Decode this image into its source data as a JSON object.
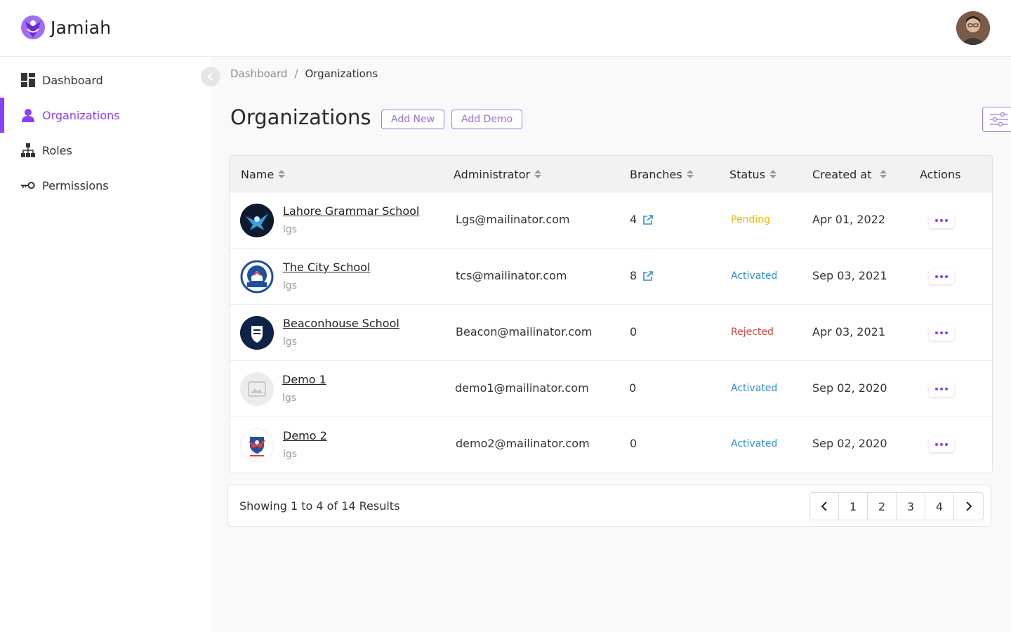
{
  "brand": {
    "name": "Jamiah",
    "accent": "#8a3ffc"
  },
  "nav": {
    "items": [
      {
        "label": "Dashboard",
        "icon": "dashboard-icon"
      },
      {
        "label": "Organizations",
        "icon": "user-icon",
        "active": true
      },
      {
        "label": "Roles",
        "icon": "hierarchy-icon"
      },
      {
        "label": "Permissions",
        "icon": "key-icon"
      }
    ]
  },
  "breadcrumb": {
    "parent": "Dashboard",
    "separator": "/",
    "current": "Organizations"
  },
  "page": {
    "title": "Organizations",
    "add_new_label": "Add New",
    "add_demo_label": "Add Demo"
  },
  "table": {
    "columns": {
      "name": "Name",
      "administrator": "Administrator",
      "branches": "Branches",
      "status": "Status",
      "created_at": "Created at",
      "actions": "Actions"
    },
    "rows": [
      {
        "name": "Lahore Grammar School",
        "code": "lgs",
        "admin": "Lgs@mailinator.com",
        "branches": "4",
        "status": "Pending",
        "status_color": "#f5b700",
        "created": "Apr 01, 2022"
      },
      {
        "name": "The City School",
        "code": "lgs",
        "admin": "tcs@mailinator.com",
        "branches": "8",
        "status": "Activated",
        "status_color": "#2d8fd5",
        "created": "Sep 03, 2021"
      },
      {
        "name": "Beaconhouse School",
        "code": "lgs",
        "admin": "Beacon@mailinator.com",
        "branches": "0",
        "status": "Rejected",
        "status_color": "#d9423a",
        "created": "Apr 03, 2021"
      },
      {
        "name": "Demo 1",
        "code": "lgs",
        "admin": "demo1@mailinator.com",
        "branches": "0",
        "status": "Activated",
        "status_color": "#2d8fd5",
        "created": "Sep 02, 2020"
      },
      {
        "name": "Demo 2",
        "code": "lgs",
        "admin": "demo2@mailinator.com",
        "branches": "0",
        "status": "Activated",
        "status_color": "#2d8fd5",
        "created": "Sep 02, 2020"
      }
    ]
  },
  "pagination": {
    "results_text": "Showing 1 to 4 of 14 Results",
    "pages": [
      "1",
      "2",
      "3",
      "4"
    ]
  }
}
